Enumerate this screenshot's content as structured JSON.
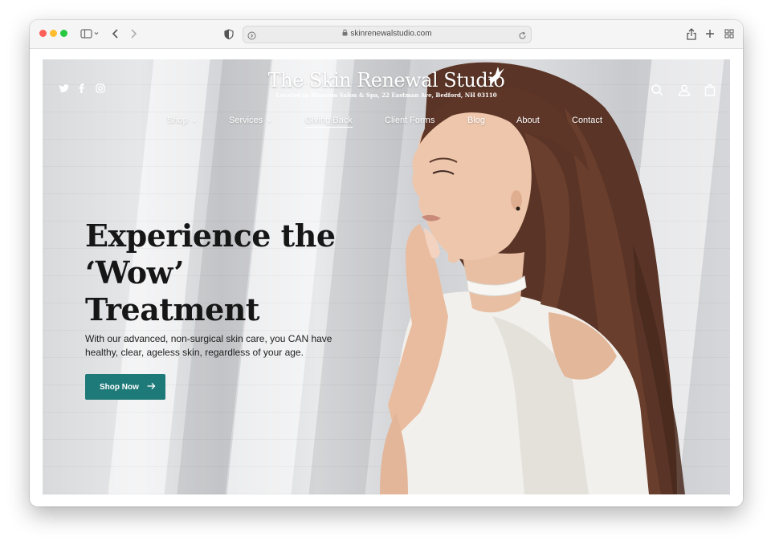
{
  "browser": {
    "url": "skinrenewalstudio.com"
  },
  "site": {
    "brand_name": "The Skin Renewal Studio",
    "brand_tagline": "Located in Blossom Salon & Spa, 22 Eastman Ave, Bedford, NH 03110",
    "social_icons": [
      "twitter-icon",
      "facebook-icon",
      "instagram-icon"
    ],
    "header_icons": [
      "search-icon",
      "account-icon",
      "bag-icon"
    ],
    "nav": [
      {
        "label": "Shop",
        "has_dropdown": true
      },
      {
        "label": "Services",
        "has_dropdown": true
      },
      {
        "label": "Giving Back",
        "active": true
      },
      {
        "label": "Client Forms"
      },
      {
        "label": "Blog"
      },
      {
        "label": "About"
      },
      {
        "label": "Contact"
      }
    ]
  },
  "hero": {
    "headline_line1": "Experience the",
    "headline_line2": "‘Wow’",
    "headline_line3": "Treatment",
    "subcopy": "With our advanced, non-surgical skin care, you CAN have healthy, clear, ageless skin, regardless of your age.",
    "cta_label": "Shop Now"
  },
  "colors": {
    "cta_bg": "#1e7a78",
    "headline": "#161616"
  }
}
